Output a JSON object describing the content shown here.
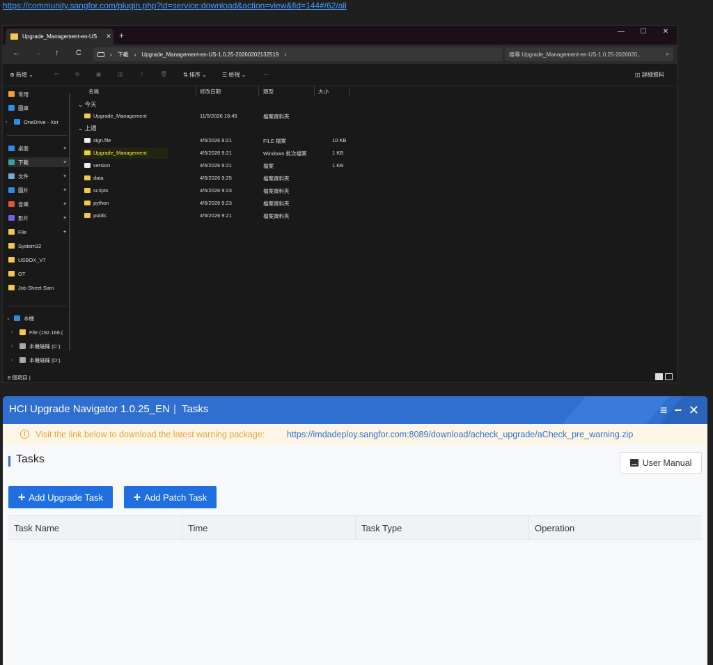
{
  "top_link": "https://community.sangfor.com/plugin.php?id=service:download&action=view&fid=144#/62/all",
  "explorer": {
    "tab_title": "Upgrade_Management-en-US",
    "tab_close": "✕",
    "new_tab": "+",
    "win_controls": [
      "—",
      "☐",
      "✕"
    ],
    "nav_buttons": [
      "←",
      "→",
      "↑",
      "C"
    ],
    "breadcrumb": [
      "下載",
      "Upgrade_Management-en-US-1.0.25-20260202132519"
    ],
    "breadcrumb_sep": "›",
    "search_placeholder": "搜尋 Upgrade_Management-en-US-1.0.25-2026020...",
    "search_icon": "⌕",
    "commands": {
      "new": "⊕ 新增 ⌄",
      "sort": "⇅ 排序 ⌄",
      "view": "☰ 檢視 ⌄",
      "more": "···",
      "details": "詳細資料"
    },
    "columns": [
      "名稱",
      "修改日期",
      "類型",
      "大小"
    ],
    "nav_items": [
      {
        "label": "常用",
        "icon": "home-icon",
        "color": "#f0a030"
      },
      {
        "label": "圖庫",
        "icon": "gallery-icon",
        "color": "#2d8ee6"
      },
      {
        "label": "OneDrive - Xer",
        "icon": "cloud-icon",
        "color": "#2d8ee6"
      },
      {
        "label": "桌面",
        "icon": "desktop-icon",
        "color": "#2d8ee6"
      },
      {
        "label": "下載",
        "icon": "download-icon",
        "color": "#3aa0a0"
      },
      {
        "label": "文件",
        "icon": "document-icon",
        "color": "#7aa6d8"
      },
      {
        "label": "圖片",
        "icon": "pictures-icon",
        "color": "#2d8ee6"
      },
      {
        "label": "音樂",
        "icon": "music-icon",
        "color": "#e0573a"
      },
      {
        "label": "影片",
        "icon": "video-icon",
        "color": "#7b5ce0"
      },
      {
        "label": "File",
        "icon": "folder-icon",
        "color": "#f2c94c"
      },
      {
        "label": "System32",
        "icon": "folder-icon",
        "color": "#f2c94c"
      },
      {
        "label": "USBOX_V7",
        "icon": "folder-icon",
        "color": "#f2c94c"
      },
      {
        "label": "OT",
        "icon": "folder-icon",
        "color": "#f2c94c"
      },
      {
        "label": "Job Sheet Sam",
        "icon": "folder-icon",
        "color": "#f2c94c"
      },
      {
        "label": "本機",
        "icon": "pc-icon",
        "color": "#2d8ee6"
      },
      {
        "label": "File (192.168.(",
        "icon": "network-folder-icon",
        "color": "#f2c94c"
      },
      {
        "label": "本機磁碟 (C:)",
        "icon": "drive-icon",
        "color": "#aaaaaa"
      },
      {
        "label": "本機磁碟 (D:)",
        "icon": "drive-icon",
        "color": "#aaaaaa"
      }
    ],
    "groups": [
      "⌄ 今天",
      "⌄ 上週"
    ],
    "files_today": [
      {
        "name": "Upgrade_Management",
        "date": "11/5/2026 16:45",
        "type": "檔案資料夾",
        "size": "",
        "icon": "folder-icon"
      }
    ],
    "files_last_week": [
      {
        "name": "sign.file",
        "date": "4/5/2026 9:21",
        "type": "FILE 檔案",
        "size": "10 KB",
        "icon": "file-icon"
      },
      {
        "name": "Upgrade_Management",
        "date": "4/5/2026 9:21",
        "type": "Windows 批次檔案",
        "size": "1 KB",
        "icon": "batch-icon"
      },
      {
        "name": "version",
        "date": "4/5/2026 9:21",
        "type": "檔案",
        "size": "1 KB",
        "icon": "file-icon"
      },
      {
        "name": "data",
        "date": "4/5/2026 9:25",
        "type": "檔案資料夾",
        "size": "",
        "icon": "folder-icon"
      },
      {
        "name": "scripts",
        "date": "4/5/2026 9:23",
        "type": "檔案資料夾",
        "size": "",
        "icon": "folder-icon"
      },
      {
        "name": "python",
        "date": "4/5/2026 9:23",
        "type": "檔案資料夾",
        "size": "",
        "icon": "folder-icon"
      },
      {
        "name": "public",
        "date": "4/5/2026 9:21",
        "type": "檔案資料夾",
        "size": "",
        "icon": "folder-icon"
      }
    ],
    "status": "8 個項目 |"
  },
  "hci": {
    "title": "HCI Upgrade Navigator 1.0.25_EN",
    "title_sep": "|",
    "subtitle": "Tasks",
    "controls": [
      "≡",
      "−",
      "✕"
    ],
    "warning_icon": "!",
    "warning_text": "Visit the link below to download the latest warning package:",
    "warning_link": "https://imdadeploy.sangfor.com:8089/download/acheck_upgrade/aCheck_pre_warning.zip",
    "section_title": "Tasks",
    "user_manual": "User Manual",
    "add_upgrade": "Add Upgrade Task",
    "add_patch": "Add Patch Task",
    "plus": "+",
    "table_headers": [
      "Task Name",
      "Time",
      "Task Type",
      "Operation"
    ],
    "colors": {
      "primary": "#1f6fe0",
      "titlebar": "#2f6fcf",
      "warning": "#e6a23c"
    }
  }
}
